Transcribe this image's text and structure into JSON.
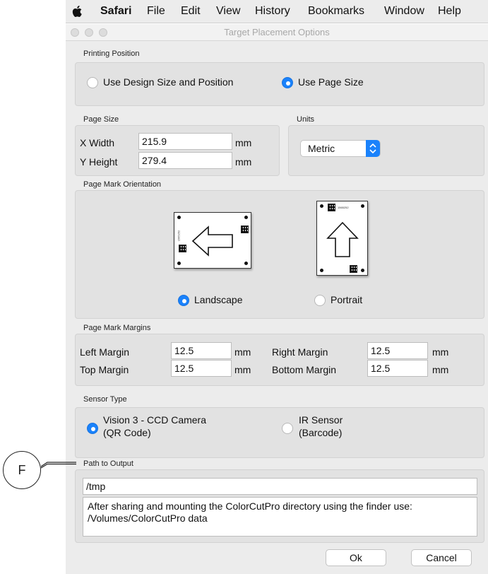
{
  "menubar": {
    "app": "Safari",
    "items": [
      "File",
      "Edit",
      "View",
      "History",
      "Bookmarks",
      "Window",
      "Help"
    ],
    "apple_icon": "apple-logo-icon"
  },
  "window": {
    "title": "Target Placement Options"
  },
  "printing_position": {
    "label": "Printing Position",
    "option_design": "Use Design Size and Position",
    "option_page": "Use Page Size",
    "selected": "Use Page Size"
  },
  "page_size": {
    "label": "Page Size",
    "x_label": "X Width",
    "x_value": "215.9",
    "x_unit": "mm",
    "y_label": "Y Height",
    "y_value": "279.4",
    "y_unit": "mm"
  },
  "units": {
    "label": "Units",
    "value": "Metric"
  },
  "orientation": {
    "label": "Page Mark Orientation",
    "landscape": "Landscape",
    "portrait": "Portrait",
    "selected": "Landscape",
    "card_code": "1565252"
  },
  "margins": {
    "label": "Page Mark Margins",
    "left_label": "Left Margin",
    "left_value": "12.5",
    "right_label": "Right Margin",
    "right_value": "12.5",
    "top_label": "Top Margin",
    "top_value": "12.5",
    "bottom_label": "Bottom Margin",
    "bottom_value": "12.5",
    "unit": "mm"
  },
  "sensor": {
    "label": "Sensor Type",
    "vision_line1": "Vision 3 - CCD Camera",
    "vision_line2": "(QR Code)",
    "ir_line1": "IR Sensor",
    "ir_line2": "(Barcode)",
    "selected": "Vision 3 - CCD Camera"
  },
  "output": {
    "label": "Path to Output",
    "path_value": "/tmp",
    "note_line1": "After sharing and mounting the ColorCutPro directory using the finder use:",
    "note_line2": "/Volumes/ColorCutPro data"
  },
  "buttons": {
    "ok": "Ok",
    "cancel": "Cancel"
  },
  "callout": {
    "letter": "F"
  },
  "colors": {
    "accent": "#1a82fb",
    "panel": "#e2e2e2",
    "window": "#ececec"
  }
}
